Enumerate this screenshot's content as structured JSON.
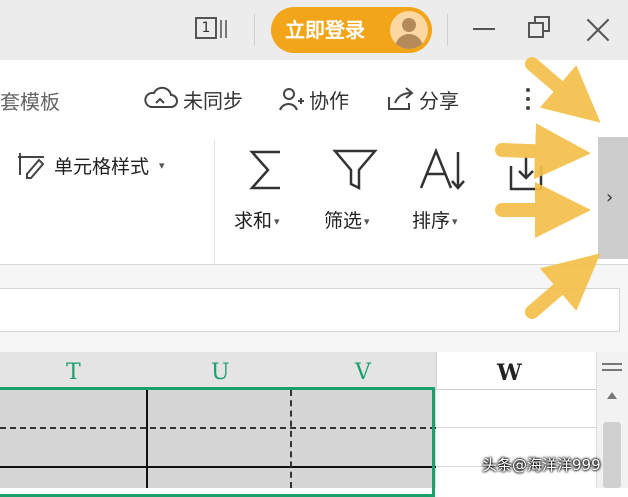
{
  "titlebar": {
    "window_count": "1",
    "login_label": "立即登录"
  },
  "menu": {
    "template_label": "套模板",
    "items": [
      {
        "label": "未同步",
        "icon": "cloud-sync-icon"
      },
      {
        "label": "协作",
        "icon": "collaborate-user-icon"
      },
      {
        "label": "分享",
        "icon": "share-icon"
      }
    ]
  },
  "ribbon": {
    "cell_style_label": "单元格样式",
    "tools": [
      {
        "label": "求和",
        "icon": "sigma-icon"
      },
      {
        "label": "筛选",
        "icon": "filter-icon"
      },
      {
        "label": "排序",
        "icon": "sort-icon"
      }
    ],
    "partial_tool_icon": "import-icon"
  },
  "sheet": {
    "columns": [
      "T",
      "U",
      "V",
      "W"
    ]
  },
  "watermark": "头条@海洋洋999",
  "colors": {
    "accent_orange": "#f3a51a",
    "selection_green": "#1aa06d",
    "arrow_yellow": "#f5c04a"
  }
}
